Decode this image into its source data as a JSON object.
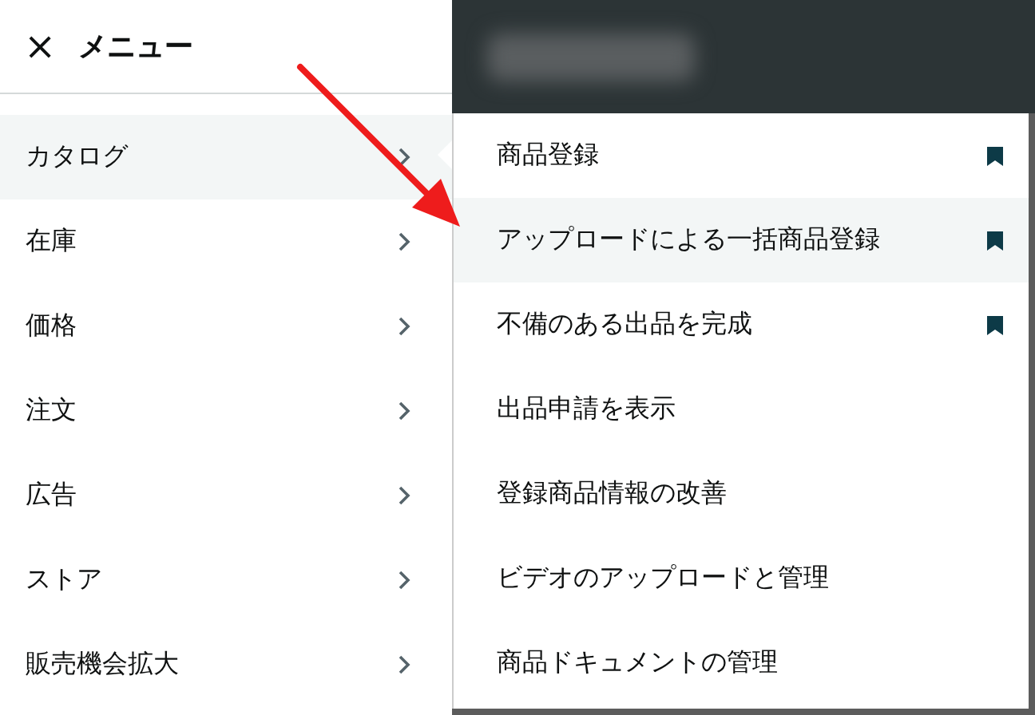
{
  "menu": {
    "close_icon": "×",
    "title": "メニュー",
    "items": [
      {
        "label": "カタログ",
        "selected": true
      },
      {
        "label": "在庫",
        "selected": false
      },
      {
        "label": "価格",
        "selected": false
      },
      {
        "label": "注文",
        "selected": false
      },
      {
        "label": "広告",
        "selected": false
      },
      {
        "label": "ストア",
        "selected": false
      },
      {
        "label": "販売機会拡大",
        "selected": false
      }
    ]
  },
  "submenu": {
    "items": [
      {
        "label": "商品登録",
        "bookmarked": true,
        "selected": false
      },
      {
        "label": "アップロードによる一括商品登録",
        "bookmarked": true,
        "selected": true
      },
      {
        "label": "不備のある出品を完成",
        "bookmarked": true,
        "selected": false
      },
      {
        "label": "出品申請を表示",
        "bookmarked": false,
        "selected": false
      },
      {
        "label": "登録商品情報の改善",
        "bookmarked": false,
        "selected": false
      },
      {
        "label": "ビデオのアップロードと管理",
        "bookmarked": false,
        "selected": false
      },
      {
        "label": "商品ドキュメントの管理",
        "bookmarked": false,
        "selected": false
      }
    ]
  }
}
